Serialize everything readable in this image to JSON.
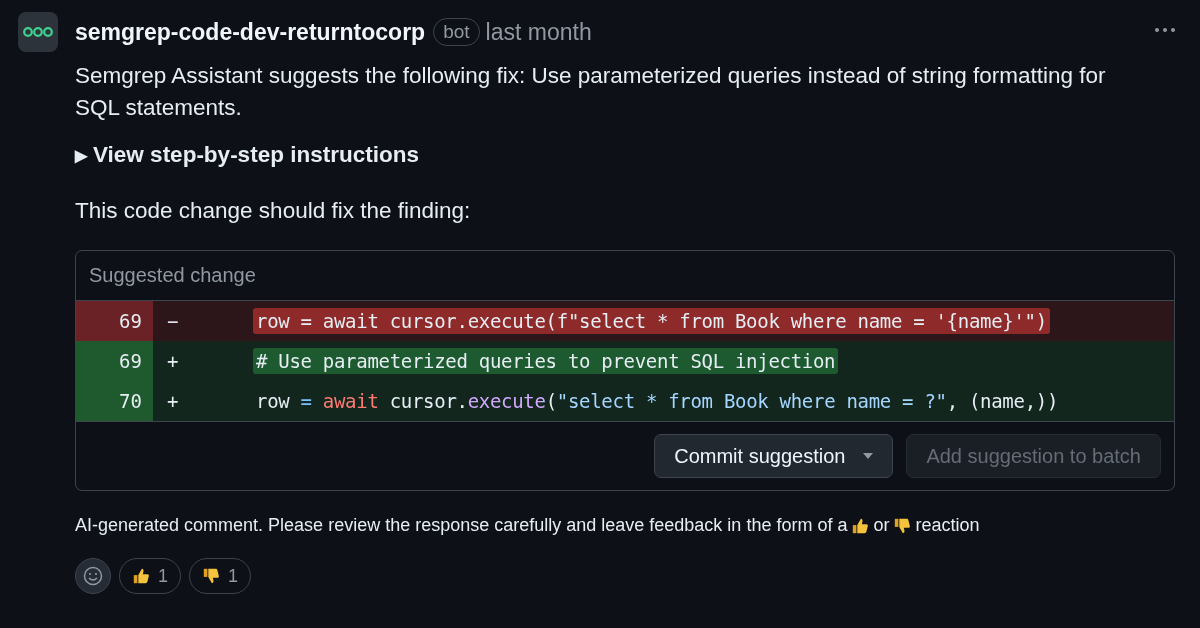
{
  "header": {
    "author": "semgrep-code-dev-returntocorp",
    "badge": "bot",
    "time": "last month"
  },
  "body": {
    "summary": "Semgrep Assistant suggests the following fix: Use parameterized queries instead of string formatting for SQL statements.",
    "details": {
      "marker": "▶",
      "label": "View step-by-step instructions",
      "expanded": false
    },
    "intro": "This code change should fix the finding:"
  },
  "suggestion": {
    "title": "Suggested change",
    "lines": [
      {
        "kind": "del",
        "number": "69",
        "sign": "−",
        "tokens": [
          {
            "text": "row = await cursor.execute(f\"select * from Book where name = '{name}'\")",
            "kind": "plain"
          }
        ]
      },
      {
        "kind": "add",
        "number": "69",
        "sign": "+",
        "tokens": [
          {
            "text": "# Use parameterized queries to prevent SQL injection",
            "kind": "plain"
          }
        ]
      },
      {
        "kind": "add",
        "number": "70",
        "sign": "+",
        "tokens": [
          {
            "text": "row ",
            "kind": "plain"
          },
          {
            "text": "=",
            "kind": "op"
          },
          {
            "text": " await",
            "kind": "keyword"
          },
          {
            "text": " cursor.",
            "kind": "plain"
          },
          {
            "text": "execute",
            "kind": "func"
          },
          {
            "text": "(",
            "kind": "plain"
          },
          {
            "text": "\"select * from Book where name = ?\"",
            "kind": "string"
          },
          {
            "text": ", (name,))",
            "kind": "plain"
          }
        ]
      }
    ],
    "buttons": [
      {
        "label": "Commit suggestion",
        "dropdown": true,
        "disabled": false
      },
      {
        "label": "Add suggestion to batch",
        "dropdown": false,
        "disabled": true
      }
    ]
  },
  "notice": {
    "before": "AI-generated comment. Please review the response carefully and leave feedback in the form of a",
    "middle": "or",
    "after": "reaction"
  },
  "reactions": [
    {
      "kind": "thumbs-up",
      "count": "1"
    },
    {
      "kind": "thumbs-down",
      "count": "1"
    }
  ]
}
